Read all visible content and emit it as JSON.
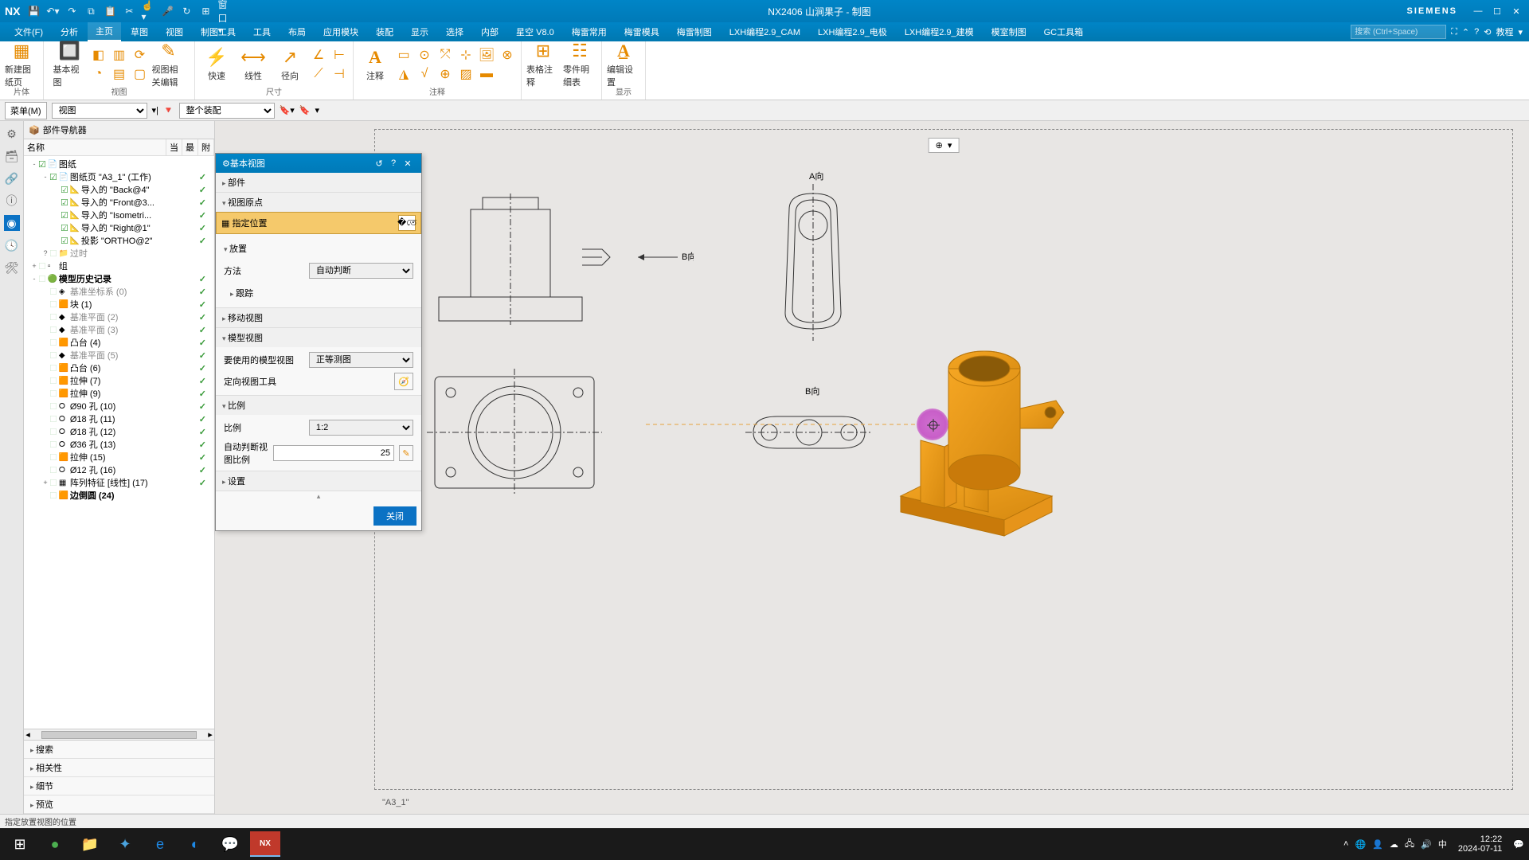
{
  "title": "NX2406 山涧果子 - 制图",
  "brand": "SIEMENS",
  "menu": {
    "items": [
      "文件(F)",
      "分析",
      "主页",
      "草图",
      "视图",
      "制图工具",
      "工具",
      "布局",
      "应用模块",
      "装配",
      "显示",
      "选择",
      "内部",
      "星空 V8.0",
      "梅雷常用",
      "梅雷模具",
      "梅雷制图",
      "LXH编程2.9_CAM",
      "LXH编程2.9_电极",
      "LXH编程2.9_建模",
      "模室制图",
      "GC工具箱"
    ],
    "active": 2
  },
  "search_ph": "搜索 (Ctrl+Space)",
  "help_label": "教程",
  "ribbon": {
    "g1": {
      "label": "片体",
      "big": "新建图纸页"
    },
    "g2": {
      "label": "视图",
      "big1": "基本视图",
      "big2": "视图相关编辑"
    },
    "g3": {
      "label": "尺寸",
      "big1": "快速",
      "big2": "线性",
      "big3": "径向"
    },
    "g4": {
      "label": "注释",
      "big": "注释"
    },
    "g5": {
      "label": "",
      "big1": "表格注释",
      "big2": "零件明细表"
    },
    "g6": {
      "label": "",
      "big": "编辑设置"
    },
    "g7": {
      "label": "显示"
    }
  },
  "subbar": {
    "menu_btn": "菜单(M)",
    "sel1": "视图",
    "sel2": "整个装配"
  },
  "nav": {
    "title": "部件导航器",
    "cols": [
      "名称",
      "当",
      "最",
      "附"
    ],
    "tree": [
      {
        "d": 0,
        "tw": "-",
        "chk": true,
        "ico": "📄",
        "txt": "图纸",
        "mark": ""
      },
      {
        "d": 1,
        "tw": "-",
        "chk": true,
        "ico": "📄",
        "txt": "图纸页 \"A3_1\" (工作)",
        "mark": "✓"
      },
      {
        "d": 2,
        "tw": "",
        "chk": true,
        "ico": "📐",
        "txt": "导入的 \"Back@4\"",
        "mark": "✓"
      },
      {
        "d": 2,
        "tw": "",
        "chk": true,
        "ico": "📐",
        "txt": "导入的 \"Front@3...",
        "mark": "✓"
      },
      {
        "d": 2,
        "tw": "",
        "chk": true,
        "ico": "📐",
        "txt": "导入的 \"Isometri...",
        "mark": "✓"
      },
      {
        "d": 2,
        "tw": "",
        "chk": true,
        "ico": "📐",
        "txt": "导入的 \"Right@1\"",
        "mark": "✓"
      },
      {
        "d": 2,
        "tw": "",
        "chk": true,
        "ico": "📐",
        "txt": "投影 \"ORTHO@2\"",
        "mark": "✓"
      },
      {
        "d": 1,
        "tw": "?",
        "chk": false,
        "ico": "📁",
        "txt": "过时",
        "mark": "",
        "grey": true
      },
      {
        "d": 0,
        "tw": "+",
        "chk": false,
        "ico": "▫",
        "txt": "组",
        "mark": ""
      },
      {
        "d": 0,
        "tw": "-",
        "chk": false,
        "ico": "🟢",
        "txt": "模型历史记录",
        "mark": "✓",
        "bold": true
      },
      {
        "d": 1,
        "tw": "",
        "chk": false,
        "ico": "◈",
        "txt": "基准坐标系 (0)",
        "mark": "✓",
        "grey": true
      },
      {
        "d": 1,
        "tw": "",
        "chk": false,
        "ico": "🟧",
        "txt": "块 (1)",
        "mark": "✓"
      },
      {
        "d": 1,
        "tw": "",
        "chk": false,
        "ico": "◆",
        "txt": "基准平面 (2)",
        "mark": "✓",
        "grey": true
      },
      {
        "d": 1,
        "tw": "",
        "chk": false,
        "ico": "◆",
        "txt": "基准平面 (3)",
        "mark": "✓",
        "grey": true
      },
      {
        "d": 1,
        "tw": "",
        "chk": false,
        "ico": "🟧",
        "txt": "凸台 (4)",
        "mark": "✓"
      },
      {
        "d": 1,
        "tw": "",
        "chk": false,
        "ico": "◆",
        "txt": "基准平面 (5)",
        "mark": "✓",
        "grey": true
      },
      {
        "d": 1,
        "tw": "",
        "chk": false,
        "ico": "🟧",
        "txt": "凸台 (6)",
        "mark": "✓"
      },
      {
        "d": 1,
        "tw": "",
        "chk": false,
        "ico": "🟧",
        "txt": "拉伸 (7)",
        "mark": "✓"
      },
      {
        "d": 1,
        "tw": "",
        "chk": false,
        "ico": "🟧",
        "txt": "拉伸 (9)",
        "mark": "✓"
      },
      {
        "d": 1,
        "tw": "",
        "chk": false,
        "ico": "⭘",
        "txt": "Ø90 孔 (10)",
        "mark": "✓"
      },
      {
        "d": 1,
        "tw": "",
        "chk": false,
        "ico": "⭘",
        "txt": "Ø18 孔 (11)",
        "mark": "✓"
      },
      {
        "d": 1,
        "tw": "",
        "chk": false,
        "ico": "⭘",
        "txt": "Ø18 孔 (12)",
        "mark": "✓"
      },
      {
        "d": 1,
        "tw": "",
        "chk": false,
        "ico": "⭘",
        "txt": "Ø36 孔 (13)",
        "mark": "✓"
      },
      {
        "d": 1,
        "tw": "",
        "chk": false,
        "ico": "🟧",
        "txt": "拉伸 (15)",
        "mark": "✓"
      },
      {
        "d": 1,
        "tw": "",
        "chk": false,
        "ico": "⭘",
        "txt": "Ø12 孔 (16)",
        "mark": "✓"
      },
      {
        "d": 1,
        "tw": "+",
        "chk": false,
        "ico": "▦",
        "txt": "阵列特征 [线性] (17)",
        "mark": "✓"
      },
      {
        "d": 1,
        "tw": "",
        "chk": false,
        "ico": "🟧",
        "txt": "边倒圆 (24)",
        "mark": "",
        "bold": true
      }
    ],
    "foot": [
      "搜索",
      "相关性",
      "细节",
      "预览"
    ]
  },
  "dialog": {
    "title": "基本视图",
    "s_part": "部件",
    "s_origin": "视图原点",
    "specify": "指定位置",
    "s_place": "放置",
    "method_l": "方法",
    "method_v": "自动判断",
    "track": "跟踪",
    "s_move": "移动视图",
    "s_model": "模型视图",
    "modelview_l": "要使用的模型视图",
    "modelview_v": "正等测图",
    "orient_l": "定向视图工具",
    "s_scale": "比例",
    "scale_l": "比例",
    "scale_v": "1:2",
    "autoscale_l": "自动判断视图比例",
    "autoscale_v": "25",
    "s_settings": "设置",
    "close": "关闭"
  },
  "canvas": {
    "sheet_label": "\"A3_1\"",
    "arrow_label": "B向",
    "section_label": "A向",
    "section_b": "B向"
  },
  "status": "指定放置视图的位置",
  "clock": {
    "time": "12:22",
    "date": "2024-07-11"
  }
}
